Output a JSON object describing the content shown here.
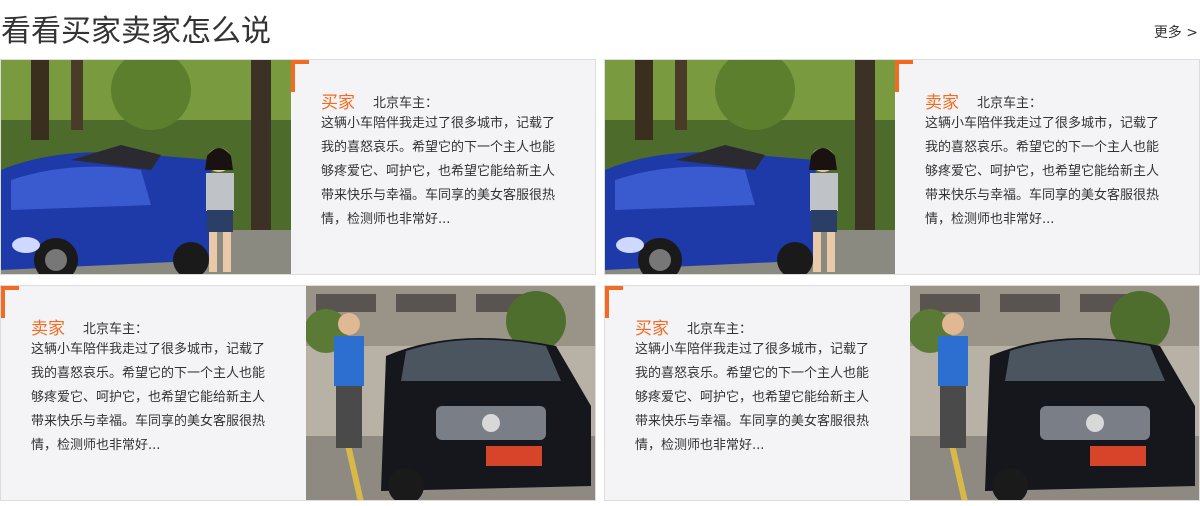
{
  "header": {
    "title": "看看买家卖家怎么说",
    "more_label": "更多 >"
  },
  "reviews": [
    {
      "role": "买家",
      "owner": "北京车主：",
      "text": "这辆小车陪伴我走过了很多城市，记载了我的喜怒哀乐。希望它的下一个主人也能够疼爱它、呵护它，也希望它能给新主人带来快乐与幸福。车同享的美女客服很热情，检测师也非常好...",
      "photo": "woman-with-blue-convertible"
    },
    {
      "role": "卖家",
      "owner": "北京车主：",
      "text": "这辆小车陪伴我走过了很多城市，记载了我的喜怒哀乐。希望它的下一个主人也能够疼爱它、呵护它，也希望它能给新主人带来快乐与幸福。车同享的美女客服很热情，检测师也非常好...",
      "photo": "woman-with-blue-convertible"
    },
    {
      "role": "卖家",
      "owner": "北京车主：",
      "text": "这辆小车陪伴我走过了很多城市，记载了我的喜怒哀乐。希望它的下一个主人也能够疼爱它、呵护它，也希望它能给新主人带来快乐与幸福。车同享的美女客服很热情，检测师也非常好...",
      "photo": "man-with-black-sedan"
    },
    {
      "role": "买家",
      "owner": "北京车主：",
      "text": "这辆小车陪伴我走过了很多城市，记载了我的喜怒哀乐。希望它的下一个主人也能够疼爱它、呵护它，也希望它能给新主人带来快乐与幸福。车同享的美女客服很热情，检测师也非常好...",
      "photo": "man-with-black-sedan"
    }
  ],
  "colors": {
    "accent": "#f26b21",
    "card_bg": "#f4f4f6",
    "border": "#dcdcdc"
  }
}
